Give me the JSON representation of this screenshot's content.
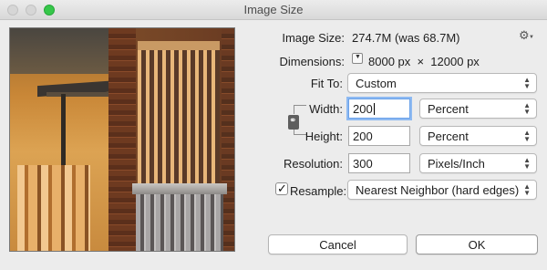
{
  "window": {
    "title": "Image Size"
  },
  "info": {
    "image_size_label": "Image Size:",
    "image_size_value": "274.7M (was 68.7M)",
    "dimensions_label": "Dimensions:",
    "dimensions_value": "8000 px  ×  12000 px"
  },
  "fit_to": {
    "label": "Fit To:",
    "value": "Custom"
  },
  "width": {
    "label": "Width:",
    "value": "200",
    "unit": "Percent"
  },
  "height": {
    "label": "Height:",
    "value": "200",
    "unit": "Percent"
  },
  "resolution": {
    "label": "Resolution:",
    "value": "300",
    "unit": "Pixels/Inch"
  },
  "resample": {
    "label": "Resample:",
    "checked": true,
    "value": "Nearest Neighbor (hard edges)"
  },
  "buttons": {
    "cancel": "Cancel",
    "ok": "OK"
  },
  "icons": {
    "settings": "gear-icon",
    "dimensions_menu": "triangle-down-icon",
    "constrain": "chain-link-icon",
    "check": "checkmark-icon",
    "select_arrows": "up-down-arrows-icon"
  },
  "colors": {
    "window_bg": "#ececec",
    "focus_ring": "#8ebaf2",
    "zoom_button": "#36c74a"
  }
}
